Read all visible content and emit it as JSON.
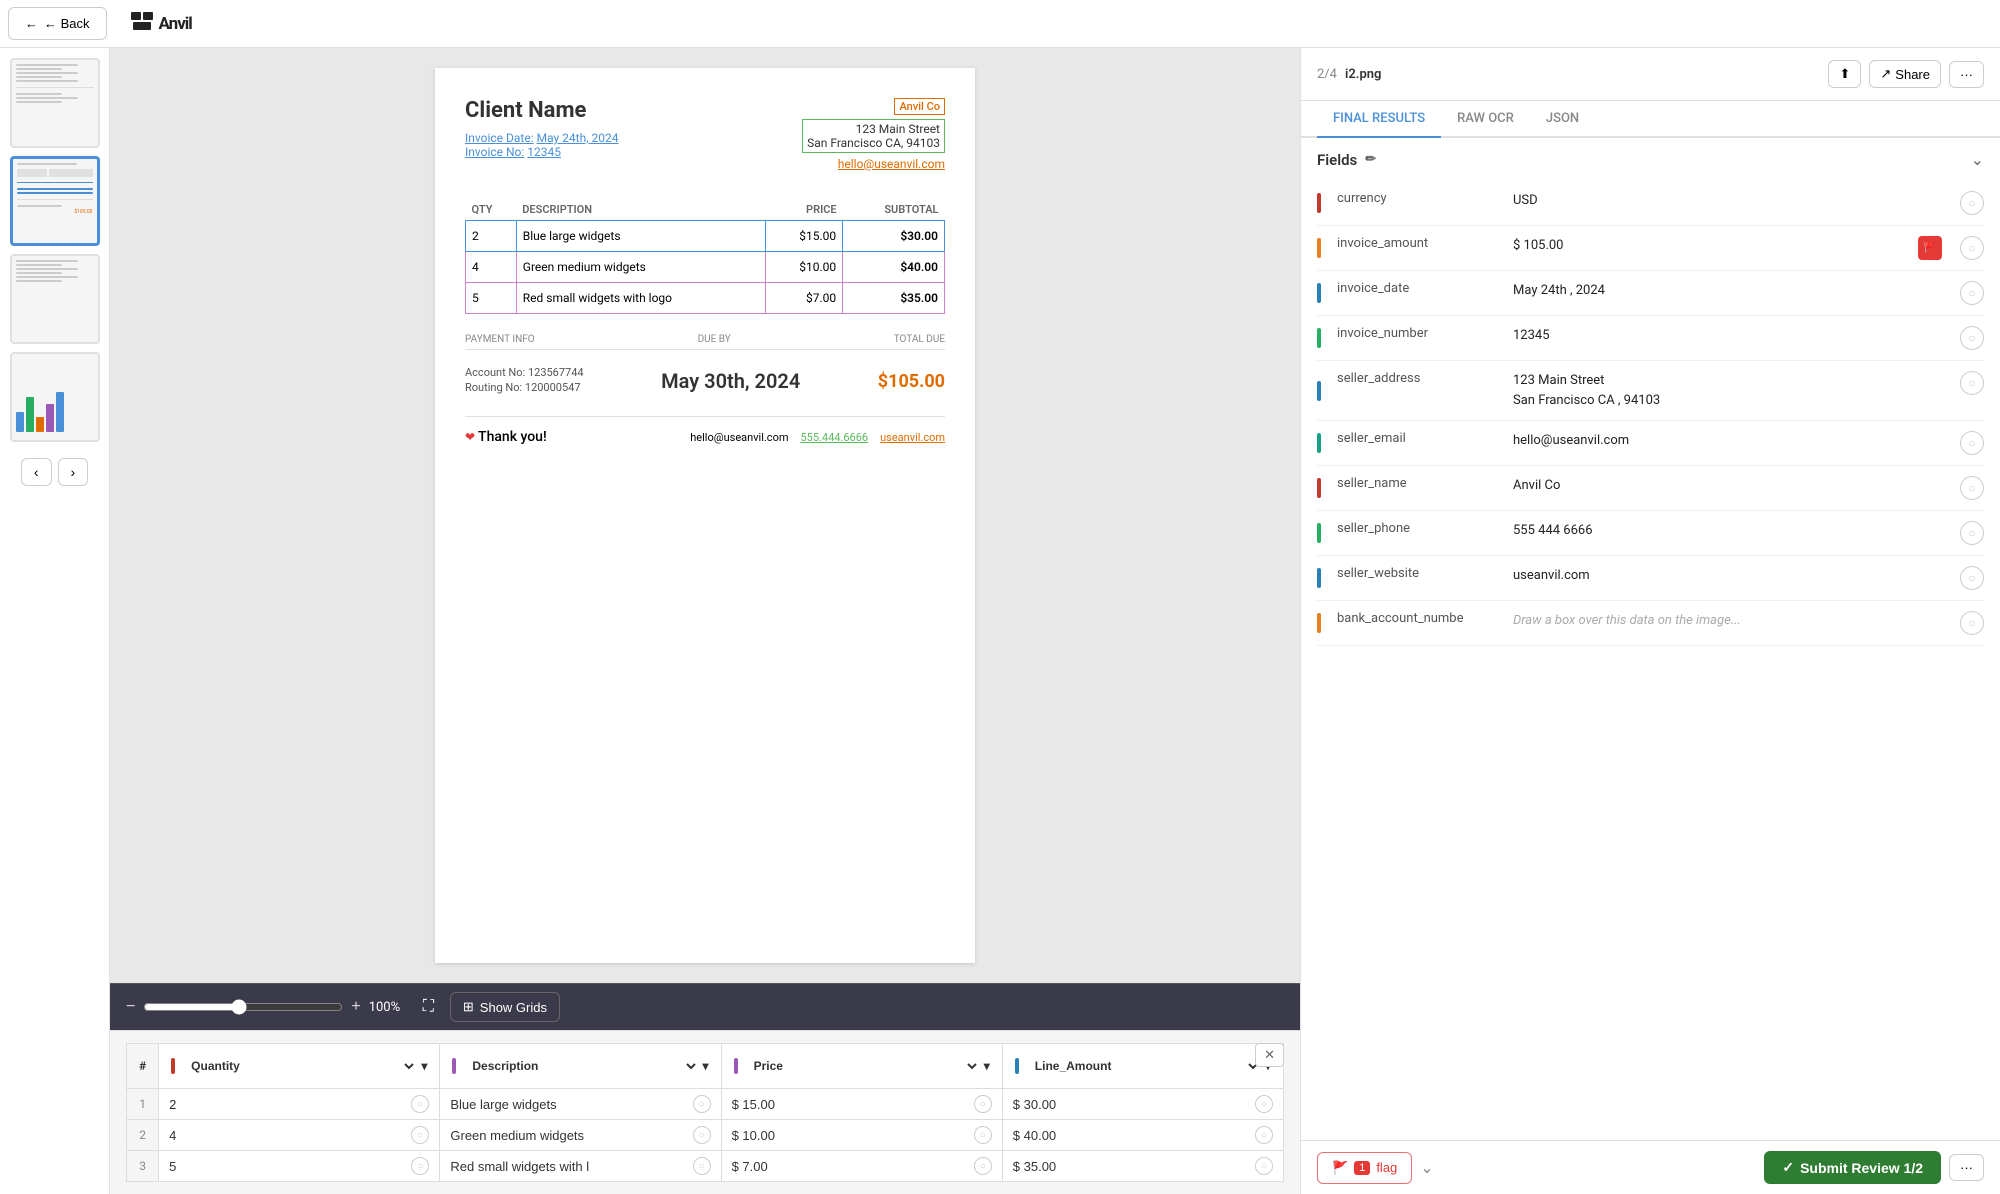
{
  "header": {
    "back_label": "← Back",
    "logo_text": "⬛ Anvil"
  },
  "right_header": {
    "page_info": "2/4",
    "filename": "i2.png",
    "upload_icon": "↑",
    "share_label": "Share",
    "more_icon": "···"
  },
  "tabs": [
    {
      "label": "FINAL RESULTS",
      "active": true
    },
    {
      "label": "RAW OCR",
      "active": false
    },
    {
      "label": "JSON",
      "active": false
    }
  ],
  "fields_section": {
    "title": "Fields",
    "edit_icon": "✏",
    "chevron": "⌄",
    "items": [
      {
        "name": "currency",
        "value": "USD",
        "color": "#c0392b",
        "has_flag": false
      },
      {
        "name": "invoice_amount",
        "value": "$ 105.00",
        "color": "#e67e22",
        "has_flag": true
      },
      {
        "name": "invoice_date",
        "value": "May 24th , 2024",
        "color": "#2980b9",
        "has_flag": false
      },
      {
        "name": "invoice_number",
        "value": "12345",
        "color": "#27ae60",
        "has_flag": false
      },
      {
        "name": "seller_address",
        "value": "123 Main Street\nSan Francisco CA , 94103",
        "color": "#2980b9",
        "has_flag": false
      },
      {
        "name": "seller_email",
        "value": "hello@useanvil.com",
        "color": "#16a085",
        "has_flag": false
      },
      {
        "name": "seller_name",
        "value": "Anvil Co",
        "color": "#c0392b",
        "has_flag": false
      },
      {
        "name": "seller_phone",
        "value": "555 444 6666",
        "color": "#27ae60",
        "has_flag": false
      },
      {
        "name": "seller_website",
        "value": "useanvil.com",
        "color": "#2980b9",
        "has_flag": false
      },
      {
        "name": "bank_account_numbe",
        "value": "Draw a box over this data on the image...",
        "color": "#e67e22",
        "has_flag": false
      }
    ]
  },
  "bottom_bar": {
    "flag_count": "1",
    "flag_label": "flag",
    "submit_label": "Submit Review 1/2",
    "check_icon": "✓",
    "more_icon": "···"
  },
  "invoice": {
    "client_name": "Client Name",
    "seller_name_badge": "Anvil Co",
    "seller_address_line1": "123 Main Street",
    "seller_address_line2": "San Francisco CA, 94103",
    "seller_email": "hello@useanvil.com",
    "invoice_date_label": "Invoice Date:",
    "invoice_date_val": "May 24th, 2024",
    "invoice_no_label": "Invoice No:",
    "invoice_no_val": "12345",
    "table_headers": [
      "QTY",
      "DESCRIPTION",
      "PRICE",
      "SUBTOTAL"
    ],
    "line_items": [
      {
        "qty": "2",
        "desc": "Blue large widgets",
        "price": "$15.00",
        "subtotal": "$30.00",
        "highlight": "blue"
      },
      {
        "qty": "4",
        "desc": "Green medium widgets",
        "price": "$10.00",
        "subtotal": "$40.00",
        "highlight": "purple"
      },
      {
        "qty": "5",
        "desc": "Red small widgets with logo",
        "price": "$7.00",
        "subtotal": "$35.00",
        "highlight": "purple"
      }
    ],
    "payment_info_label": "PAYMENT INFO",
    "due_by_label": "DUE BY",
    "total_due_label": "TOTAL DUE",
    "account_label": "Account No:",
    "account_val": "123567744",
    "routing_label": "Routing No:",
    "routing_val": "120000547",
    "due_date": "May 30th, 2024",
    "total_due_amt": "$105.00",
    "thankyou_text": "Thank you!",
    "thankyou_email": "hello@useanvil.com",
    "thankyou_phone": "555.444.6666",
    "thankyou_url": "useanvil.com"
  },
  "zoom": {
    "pct": "100%",
    "show_grids_label": "Show Grids"
  },
  "data_table": {
    "close_label": "✕",
    "columns": [
      {
        "label": "Quantity",
        "color": "#c0392b"
      },
      {
        "label": "Description",
        "color": "#9b59b6"
      },
      {
        "label": "Price",
        "color": "#9b59b6"
      },
      {
        "label": "Line_Amount",
        "color": "#2980b9"
      }
    ],
    "rows": [
      {
        "num": "1",
        "cells": [
          "2",
          "Blue large widgets",
          "$ 15.00",
          "$ 30.00"
        ]
      },
      {
        "num": "2",
        "cells": [
          "4",
          "Green medium widgets",
          "$ 10.00",
          "$ 40.00"
        ]
      },
      {
        "num": "3",
        "cells": [
          "5",
          "Red small widgets with l",
          "$ 7.00",
          "$ 35.00"
        ]
      }
    ]
  },
  "thumbnails": [
    {
      "id": 1,
      "active": false
    },
    {
      "id": 2,
      "active": true
    },
    {
      "id": 3,
      "active": false
    },
    {
      "id": 4,
      "active": false
    }
  ]
}
